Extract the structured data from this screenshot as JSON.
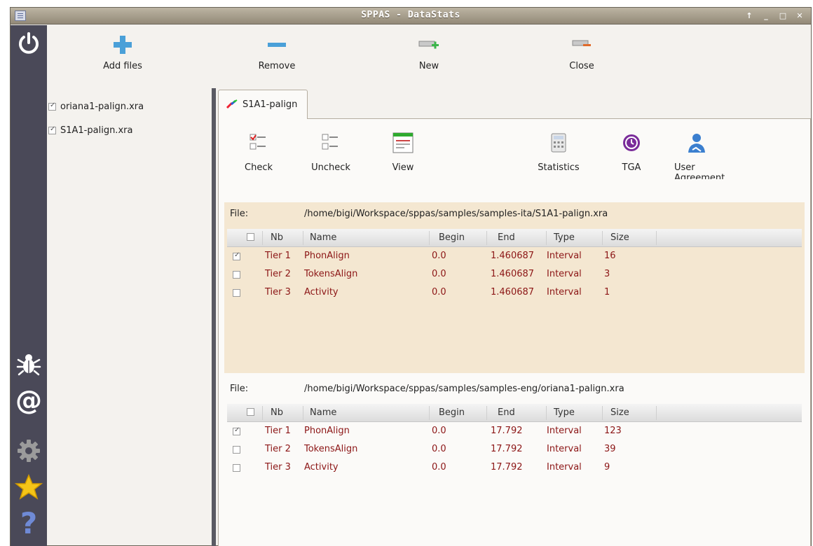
{
  "window": {
    "title": "SPPAS - DataStats"
  },
  "icons": {
    "app": "app-icon",
    "power": "power-icon",
    "bug": "bug-icon",
    "at": "at-icon",
    "gear": "gear-icon",
    "star": "star-icon",
    "help": "question-icon"
  },
  "toolbar": {
    "add_files": "Add files",
    "remove": "Remove",
    "new": "New",
    "close": "Close"
  },
  "file_tree": [
    {
      "name": "oriana1-palign.xra",
      "checked": true
    },
    {
      "name": "S1A1-palign.xra",
      "checked": true
    }
  ],
  "tab": {
    "label": "S1A1-palign"
  },
  "page_toolbar": {
    "check": "Check",
    "uncheck": "Uncheck",
    "view": "View",
    "statistics": "Statistics",
    "tga": "TGA",
    "user_agreement": "User Agreement"
  },
  "columns": [
    "Nb",
    "Name",
    "Begin",
    "End",
    "Type",
    "Size"
  ],
  "file_label": "File:",
  "files": [
    {
      "path": "/home/bigi/Workspace/sppas/samples/samples-ita/S1A1-palign.xra",
      "rows": [
        {
          "checked": true,
          "nb": "Tier 1",
          "name": "PhonAlign",
          "begin": "0.0",
          "end": "1.460687",
          "type": "Interval",
          "size": "16"
        },
        {
          "checked": false,
          "nb": "Tier 2",
          "name": "TokensAlign",
          "begin": "0.0",
          "end": "1.460687",
          "type": "Interval",
          "size": "3"
        },
        {
          "checked": false,
          "nb": "Tier 3",
          "name": "Activity",
          "begin": "0.0",
          "end": "1.460687",
          "type": "Interval",
          "size": "1"
        }
      ]
    },
    {
      "path": "/home/bigi/Workspace/sppas/samples/samples-eng/oriana1-palign.xra",
      "rows": [
        {
          "checked": true,
          "nb": "Tier 1",
          "name": "PhonAlign",
          "begin": "0.0",
          "end": "17.792",
          "type": "Interval",
          "size": "123"
        },
        {
          "checked": false,
          "nb": "Tier 2",
          "name": "TokensAlign",
          "begin": "0.0",
          "end": "17.792",
          "type": "Interval",
          "size": "39"
        },
        {
          "checked": false,
          "nb": "Tier 3",
          "name": "Activity",
          "begin": "0.0",
          "end": "17.792",
          "type": "Interval",
          "size": "9"
        }
      ]
    }
  ]
}
